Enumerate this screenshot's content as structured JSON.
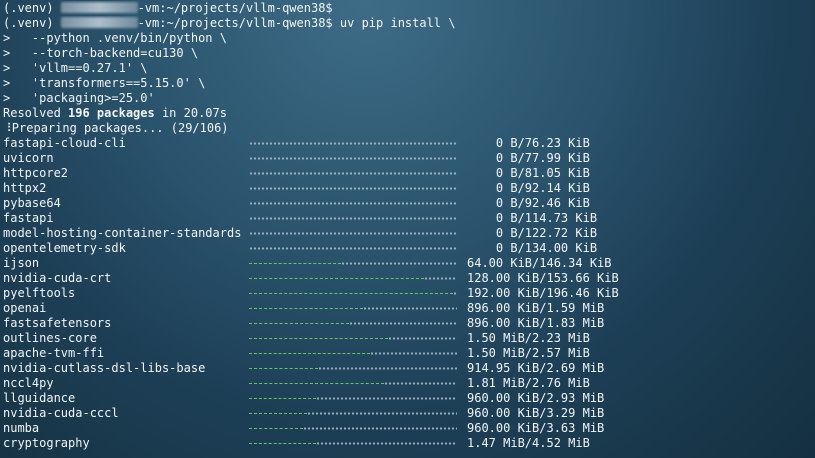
{
  "prompt": {
    "venv": "(.venv)",
    "path_suffix": "-vm:~/projects/vllm-qwen38$",
    "path_suffix_2": "-vm:~/projects/vllm-qwen38$"
  },
  "command": {
    "text": "uv pip install \\",
    "continuations": [
      ">   --python .venv/bin/python \\",
      ">   --torch-backend=cu130 \\",
      ">   'vllm==0.27.1' \\",
      ">   'transformers==5.15.0' \\",
      ">   'packaging>=25.0'"
    ]
  },
  "resolved": {
    "prefix": "Resolved ",
    "count_text": "196 packages",
    "suffix": " in 20.07s"
  },
  "preparing": {
    "spinner": "⠸",
    "text": "Preparing packages... (29/106)"
  },
  "packages": [
    {
      "name": "fastapi-cloud-cli",
      "progress": 0.0,
      "size": "    0 B/76.23 KiB"
    },
    {
      "name": "uvicorn",
      "progress": 0.0,
      "size": "    0 B/77.99 KiB"
    },
    {
      "name": "httpcore2",
      "progress": 0.0,
      "size": "    0 B/81.05 KiB"
    },
    {
      "name": "httpx2",
      "progress": 0.0,
      "size": "    0 B/92.14 KiB"
    },
    {
      "name": "pybase64",
      "progress": 0.0,
      "size": "    0 B/92.46 KiB"
    },
    {
      "name": "fastapi",
      "progress": 0.0,
      "size": "    0 B/114.73 KiB"
    },
    {
      "name": "model-hosting-container-standards",
      "progress": 0.0,
      "size": "    0 B/122.72 KiB"
    },
    {
      "name": "opentelemetry-sdk",
      "progress": 0.0,
      "size": "    0 B/134.00 KiB"
    },
    {
      "name": "ijson",
      "progress": 0.44,
      "size": "64.00 KiB/146.34 KiB"
    },
    {
      "name": "nvidia-cuda-crt",
      "progress": 0.84,
      "size": "128.00 KiB/153.66 KiB"
    },
    {
      "name": "pyelftools",
      "progress": 0.98,
      "size": "192.00 KiB/196.46 KiB"
    },
    {
      "name": "openai",
      "progress": 0.55,
      "size": "896.00 KiB/1.59 MiB"
    },
    {
      "name": "fastsafetensors",
      "progress": 0.48,
      "size": "896.00 KiB/1.83 MiB"
    },
    {
      "name": "outlines-core",
      "progress": 0.67,
      "size": "1.50 MiB/2.23 MiB"
    },
    {
      "name": "apache-tvm-ffi",
      "progress": 0.58,
      "size": "1.50 MiB/2.57 MiB"
    },
    {
      "name": "nvidia-cutlass-dsl-libs-base",
      "progress": 0.33,
      "size": "914.95 KiB/2.69 MiB"
    },
    {
      "name": "nccl4py",
      "progress": 0.65,
      "size": "1.81 MiB/2.76 MiB"
    },
    {
      "name": "llguidance",
      "progress": 0.32,
      "size": "960.00 KiB/2.93 MiB"
    },
    {
      "name": "nvidia-cuda-cccl",
      "progress": 0.28,
      "size": "960.00 KiB/3.29 MiB"
    },
    {
      "name": "numba",
      "progress": 0.26,
      "size": "960.00 KiB/3.63 MiB"
    },
    {
      "name": "cryptography",
      "progress": 0.32,
      "size": "1.47 MiB/4.52 MiB"
    }
  ]
}
